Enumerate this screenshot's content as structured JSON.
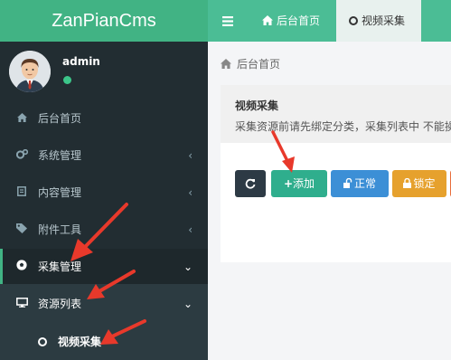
{
  "header": {
    "brand": "ZanPianCms",
    "menu_icon": "bars-icon",
    "tabs": [
      {
        "label": "后台首页",
        "icon": "home-icon"
      },
      {
        "label": "视频采集",
        "icon": "circle-icon"
      }
    ]
  },
  "user": {
    "name": "admin",
    "status_color": "#3cc68a"
  },
  "sidebar": {
    "items": [
      {
        "label": "后台首页",
        "icon": "dashboard-icon"
      },
      {
        "label": "系统管理",
        "icon": "cogs-icon"
      },
      {
        "label": "内容管理",
        "icon": "book-icon"
      },
      {
        "label": "附件工具",
        "icon": "tag-icon"
      },
      {
        "label": "采集管理",
        "icon": "soccer-ball-icon"
      },
      {
        "label": "资源列表",
        "icon": "desktop-icon"
      },
      {
        "label": "视频采集",
        "icon": "circle-icon"
      }
    ]
  },
  "breadcrumb": "后台首页",
  "callout": {
    "title": "视频采集",
    "text": "采集资源前请先绑定分类，采集列表中 不能操"
  },
  "toolbar": {
    "add": "添加",
    "normal": "正常",
    "lock": "锁定"
  },
  "colors": {
    "header": "#4bbd95",
    "sidebar": "#222d32",
    "arrow": "#e8392b"
  }
}
